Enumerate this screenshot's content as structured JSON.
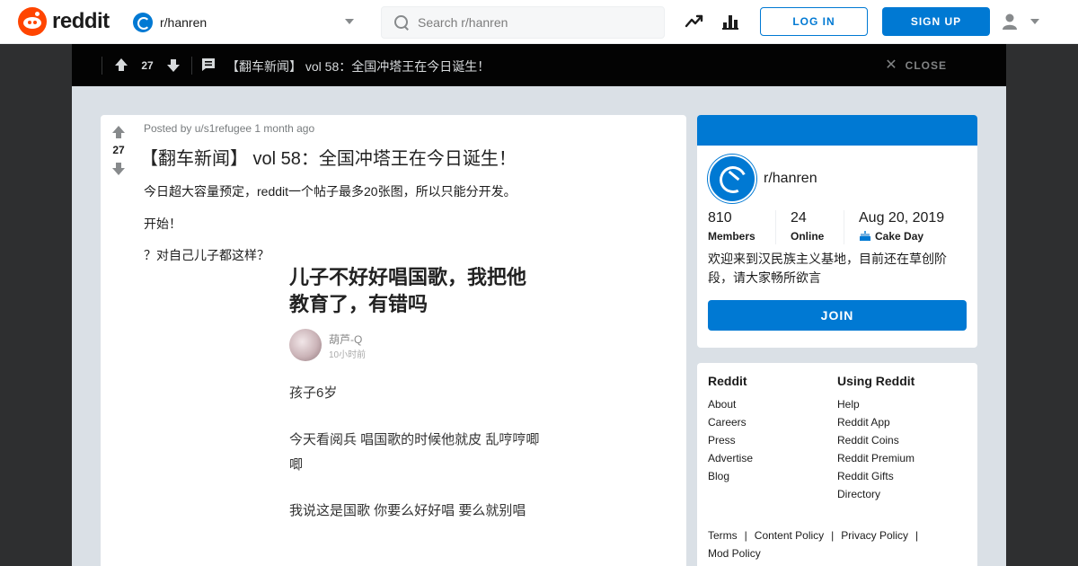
{
  "header": {
    "logo_text": "reddit",
    "community": "r/hanren",
    "search_placeholder": "Search r/hanren",
    "login_label": "LOG IN",
    "signup_label": "SIGN UP",
    "icons": [
      "trending-icon",
      "stats-icon",
      "user-icon"
    ]
  },
  "postbar": {
    "score": "27",
    "title": "【翻车新闻】 vol 58：全国冲塔王在今日诞生！",
    "close_label": "CLOSE"
  },
  "post": {
    "score": "27",
    "meta": "Posted by u/s1refugee 1 month ago",
    "title": "【翻车新闻】 vol 58：全国冲塔王在今日诞生！",
    "paragraphs": [
      "今日超大容量预定，reddit一个帖子最多20张图，所以只能分开发。",
      "开始！",
      "？对自己儿子都这样？"
    ],
    "image": {
      "title": "儿子不好好唱国歌，我把他教育了，有错吗",
      "user": "葫芦-Q",
      "time": "10小时前",
      "lines": [
        "孩子6岁",
        "今天看阅兵 唱国歌的时候他就皮 乱哼哼唧唧",
        "我说这是国歌 你要么好好唱 要么就别唱"
      ]
    }
  },
  "about": {
    "name": "r/hanren",
    "members": "810",
    "members_label": "Members",
    "online": "24",
    "online_label": "Online",
    "cake_date": "Aug 20, 2019",
    "cake_label": "Cake Day",
    "description": "欢迎来到汉民族主义基地，目前还在草创阶段，请大家畅所欲言",
    "join_label": "JOIN"
  },
  "footer": {
    "col1_head": "Reddit",
    "col1_links": [
      "About",
      "Careers",
      "Press",
      "Advertise",
      "Blog"
    ],
    "col2_head": "Using Reddit",
    "col2_links": [
      "Help",
      "Reddit App",
      "Reddit Coins",
      "Reddit Premium",
      "Reddit Gifts",
      "Directory"
    ],
    "bottom_links": [
      "Terms",
      "Content Policy",
      "Privacy Policy",
      "Mod Policy"
    ]
  },
  "colors": {
    "brand": "#ff4500",
    "accent": "#0079d3",
    "postbar_bg": "#030303",
    "content_bg": "#dae0e6"
  }
}
